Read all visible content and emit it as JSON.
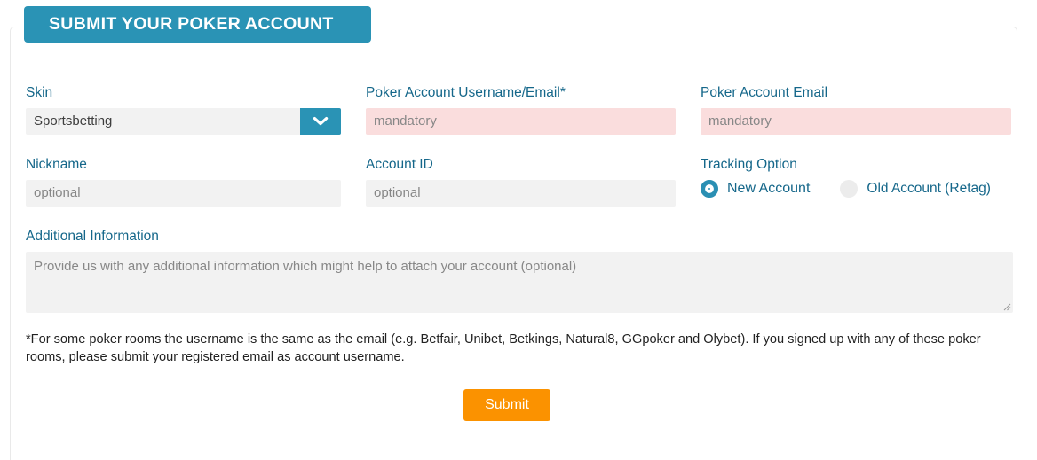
{
  "header": {
    "title": "SUBMIT YOUR POKER ACCOUNT",
    "accent_color": "#2a93b5"
  },
  "form": {
    "skin": {
      "label": "Skin",
      "value": "Sportsbetting",
      "arrow_icon": "chevron-down-icon"
    },
    "poker_username": {
      "label": "Poker Account Username/Email*",
      "placeholder": "mandatory",
      "value": "",
      "required": true,
      "bg_color": "#fadddd"
    },
    "poker_email": {
      "label": "Poker Account Email",
      "placeholder": "mandatory",
      "value": "",
      "required": true,
      "bg_color": "#fadddd"
    },
    "nickname": {
      "label": "Nickname",
      "placeholder": "optional",
      "value": ""
    },
    "account_id": {
      "label": "Account ID",
      "placeholder": "optional",
      "value": ""
    },
    "tracking_option": {
      "label": "Tracking Option",
      "options": [
        {
          "label": "New Account",
          "selected": true
        },
        {
          "label": "Old Account (Retag)",
          "selected": false
        }
      ]
    },
    "additional_information": {
      "label": "Additional Information",
      "placeholder": "Provide us with any additional information which might help to attach your account (optional)",
      "value": ""
    }
  },
  "footnote": {
    "text": "*For some poker rooms the username is the same as the email (e.g. Betfair, Unibet, Betkings, Natural8, GGpoker and Olybet). If you signed up with any of these poker rooms, please submit your registered email as account username."
  },
  "submit": {
    "label": "Submit",
    "color": "#fb9200"
  }
}
